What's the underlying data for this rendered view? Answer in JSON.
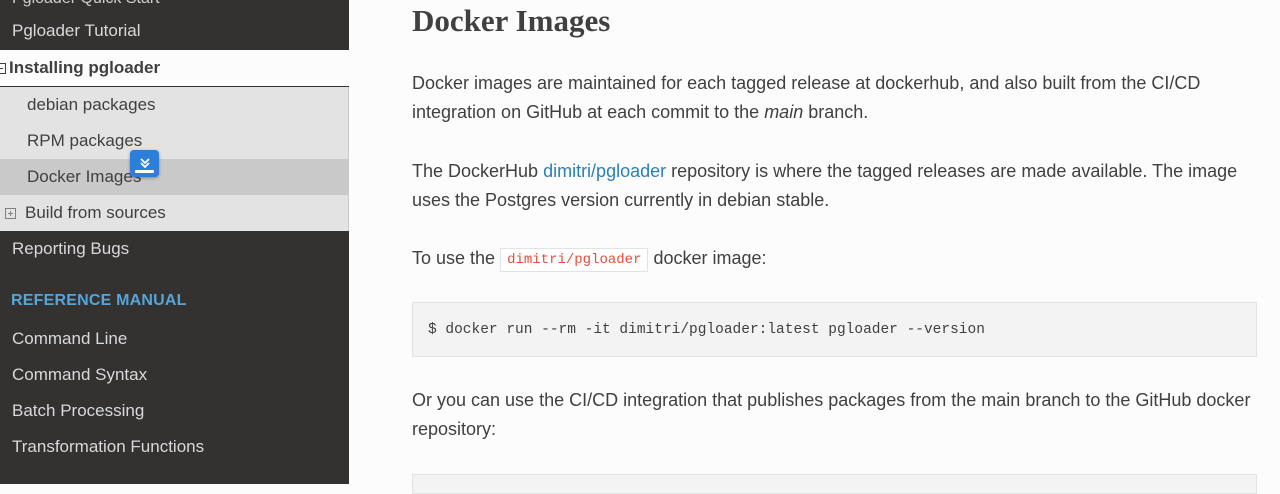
{
  "sidebar": {
    "partial_item": "Pgloader Quick Start",
    "items_top": [
      {
        "label": "Pgloader Tutorial"
      }
    ],
    "current_section": {
      "label": "Installing pgloader",
      "expander_icon": "minus-box-icon",
      "children": [
        {
          "label": "debian packages"
        },
        {
          "label": "RPM packages"
        },
        {
          "label": "Docker Images",
          "active": true
        },
        {
          "label": "Build from sources",
          "expander_icon": "plus-box-icon"
        }
      ]
    },
    "items_after": [
      {
        "label": "Reporting Bugs"
      }
    ],
    "caption": "REFERENCE MANUAL",
    "reference_items": [
      {
        "label": "Command Line"
      },
      {
        "label": "Command Syntax"
      },
      {
        "label": "Batch Processing"
      },
      {
        "label": "Transformation Functions"
      }
    ],
    "floating_badge_icon": "download-overlay-icon"
  },
  "main": {
    "title": "Docker Images",
    "p1": {
      "before": "Docker images are maintained for each tagged release at dockerhub, and also built from the CI/CD integration on GitHub at each commit to the ",
      "emphasis": "main",
      "after": " branch."
    },
    "p2": {
      "before": "The DockerHub ",
      "link": "dimitri/pgloader",
      "after": " repository is where the tagged releases are made available. The image uses the Postgres version currently in debian stable."
    },
    "p3": {
      "before": "To use the ",
      "code": "dimitri/pgloader",
      "after": " docker image:"
    },
    "code_block": "$ docker run --rm -it dimitri/pgloader:latest pgloader --version",
    "p4": "Or you can use the CI/CD integration that publishes packages from the main branch to the GitHub docker repository:"
  },
  "colors": {
    "sidebar_bg": "#343131",
    "caption": "#55a5d9",
    "link": "#2980b9",
    "inline_code": "#e74c3c",
    "text": "#404040"
  }
}
